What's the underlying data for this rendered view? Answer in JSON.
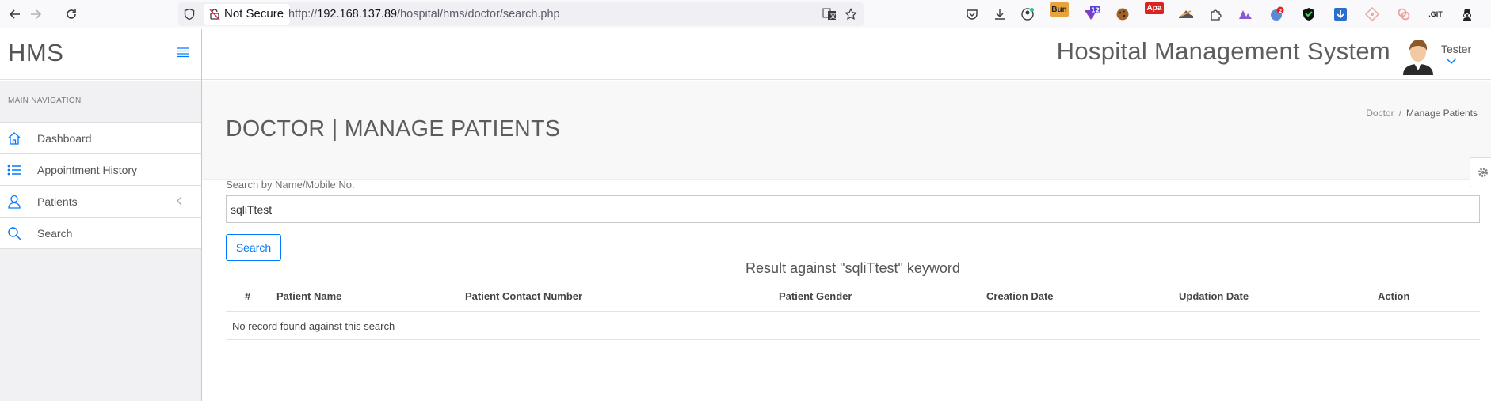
{
  "browser": {
    "security_label": "Not Secure",
    "url_prefix": "http://",
    "url_host": "192.168.137.89",
    "url_path": "/hospital/hms/doctor/search.php",
    "extensions": [
      {
        "name": "burp",
        "text": "Bun",
        "color": "#e8a33c"
      },
      {
        "name": "counter",
        "text": "12",
        "color": "#7b3fbf"
      },
      {
        "name": "apa",
        "text": "Apa",
        "color": "#d22"
      },
      {
        "name": "git",
        "text": ".GIT",
        "color": "#222"
      }
    ]
  },
  "header": {
    "brand": "HMS",
    "app_title": "Hospital Management System",
    "username": "Tester"
  },
  "sidebar": {
    "section_header": "MAIN NAVIGATION",
    "items": [
      {
        "label": "Dashboard",
        "icon": "home-icon"
      },
      {
        "label": "Appointment History",
        "icon": "list-icon"
      },
      {
        "label": "Patients",
        "icon": "user-icon"
      },
      {
        "label": "Search",
        "icon": "search-icon"
      }
    ]
  },
  "page": {
    "title": "DOCTOR | MANAGE PATIENTS",
    "breadcrumb": [
      "Doctor",
      "Manage Patients"
    ],
    "search_label": "Search by Name/Mobile No.",
    "search_value": "sqliTtest",
    "search_button": "Search",
    "result_heading": "Result against \"sqliTtest\" keyword",
    "table": {
      "columns": [
        "#",
        "Patient Name",
        "Patient Contact Number",
        "Patient Gender",
        "Creation Date",
        "Updation Date",
        "Action"
      ],
      "empty_message": "No record found against this search"
    }
  },
  "colors": {
    "accent": "#007aff",
    "sidebar_bg": "#f1f1f3",
    "header_bg": "#f8f8f8"
  }
}
